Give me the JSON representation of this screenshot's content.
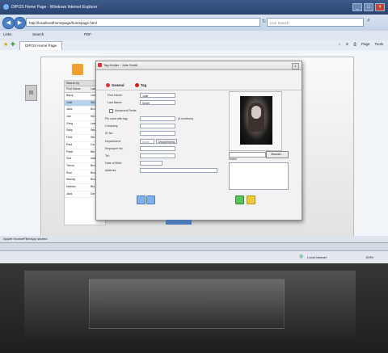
{
  "browser": {
    "title": "DIPOS Home Page - Windows Internet Explorer",
    "address": "http://localhost/homepage/homepage.html",
    "search_placeholder": "Live Search",
    "links_label": "Links",
    "links_search": "Search",
    "links_pdf": "PDF",
    "tab_label": "DIPOS Home Page",
    "cmd_page": "Page",
    "cmd_tools": "Tools",
    "status_text": "Applet InvoiceFilterApp started",
    "status_zone": "Local intranet",
    "zoom": "100%"
  },
  "users": {
    "top_label": "Search by",
    "column_first": "First Name",
    "column_last": "Last",
    "rows": [
      {
        "first": "Barry",
        "last": "Lee"
      },
      {
        "first": "Julie",
        "last": "Sm"
      },
      {
        "first": "Jack",
        "last": "Bro"
      },
      {
        "first": "Joe",
        "last": "Wo"
      },
      {
        "first": "Greg",
        "last": "Lee"
      },
      {
        "first": "Sally",
        "last": "Wa"
      },
      {
        "first": "Fred",
        "last": "Ste"
      },
      {
        "first": "Paul",
        "last": "Ca"
      },
      {
        "first": "Peter",
        "last": "Ble"
      },
      {
        "first": "Sue",
        "last": "Ada"
      },
      {
        "first": "Trevor",
        "last": "Bro"
      },
      {
        "first": "Rod",
        "last": "Bro"
      },
      {
        "first": "Wendy",
        "last": "Bro"
      },
      {
        "first": "Nathan",
        "last": "Bla"
      },
      {
        "first": "Jack",
        "last": "Dix"
      }
    ],
    "selected_index": 1
  },
  "dialog": {
    "title": "Tag Holder : Julie Smith",
    "tab_general": "General",
    "tab_tag": "Tag",
    "first_name_label": "First Name:",
    "first_name_value": "Julie",
    "last_name_label": "Last Name:",
    "last_name_value": "Smith",
    "advanced_label": "Advanced Fields",
    "pin_label": "Pin used with tag:",
    "pin_hint": "(4 numbers)",
    "company_label": "Company:",
    "id_label": "ID No:",
    "department_label": "Department:",
    "department_value": "None",
    "departments_button": "Departments",
    "employee_label": "Employee No:",
    "tel_label": "Tel:",
    "dob_label": "Date of Birth:",
    "address_label": "Address:",
    "browse_label": "Browse...",
    "notes_label": "Notes:"
  }
}
